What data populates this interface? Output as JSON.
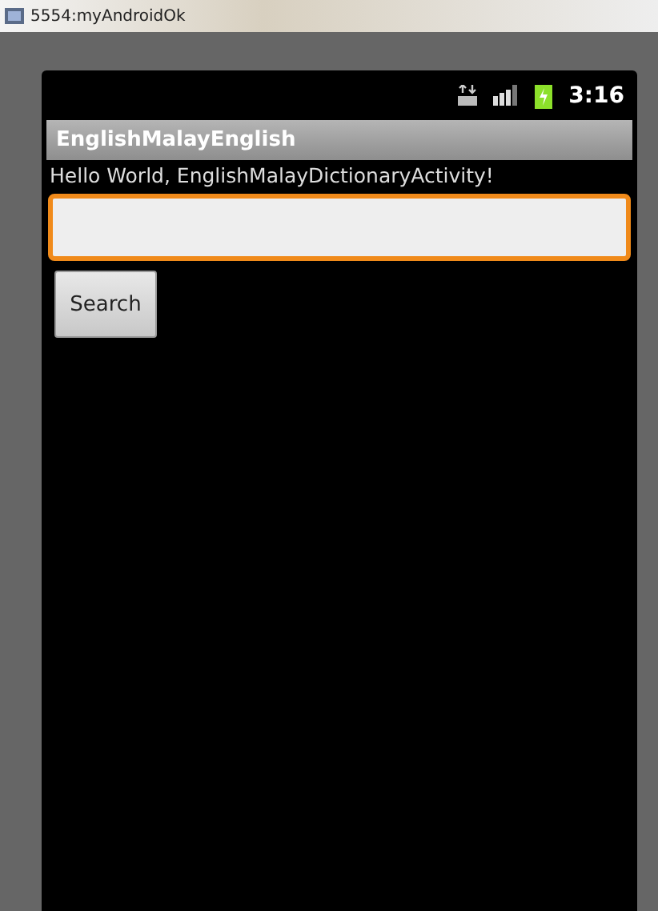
{
  "window": {
    "title": "5554:myAndroidOk"
  },
  "status_bar": {
    "time": "3:16"
  },
  "app_bar": {
    "title": "EnglishMalayEnglish"
  },
  "greeting": "Hello World, EnglishMalayDictionaryActivity!",
  "search_field": {
    "focused": true
  },
  "search_button": {
    "label": "Search"
  }
}
